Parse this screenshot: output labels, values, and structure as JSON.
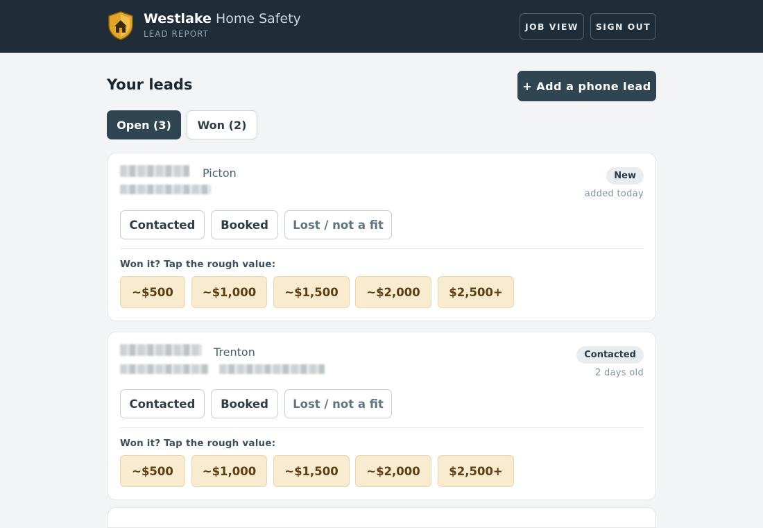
{
  "header": {
    "brand_bold": "Westlake",
    "brand_light": "Home Safety",
    "subtitle": "LEAD REPORT",
    "nav": [
      "JOB VIEW",
      "SIGN OUT"
    ],
    "logo_icon": "shield-house-icon"
  },
  "page": {
    "title": "Your leads",
    "add_button": "+ Add a phone lead",
    "tabs": [
      "Open (3)",
      "Won (2)"
    ]
  },
  "leads": [
    {
      "city": "Picton",
      "status": "New",
      "age": "added today",
      "actions": [
        "Contacted",
        "Booked",
        "Lost / not a fit"
      ],
      "won_label": "Won it? Tap the rough value:",
      "values": [
        "~$500",
        "~$1,000",
        "~$1,500",
        "~$2,000",
        "$2,500+"
      ]
    },
    {
      "city": "Trenton",
      "status": "Contacted",
      "age": "2 days old",
      "actions": [
        "Contacted",
        "Booked",
        "Lost / not a fit"
      ],
      "won_label": "Won it? Tap the rough value:",
      "values": [
        "~$500",
        "~$1,000",
        "~$1,500",
        "~$2,000",
        "$2,500+"
      ]
    }
  ],
  "colors": {
    "topbar": "#1e2d37",
    "accent": "#2f4552",
    "value_chip": "#f8ebcf"
  }
}
